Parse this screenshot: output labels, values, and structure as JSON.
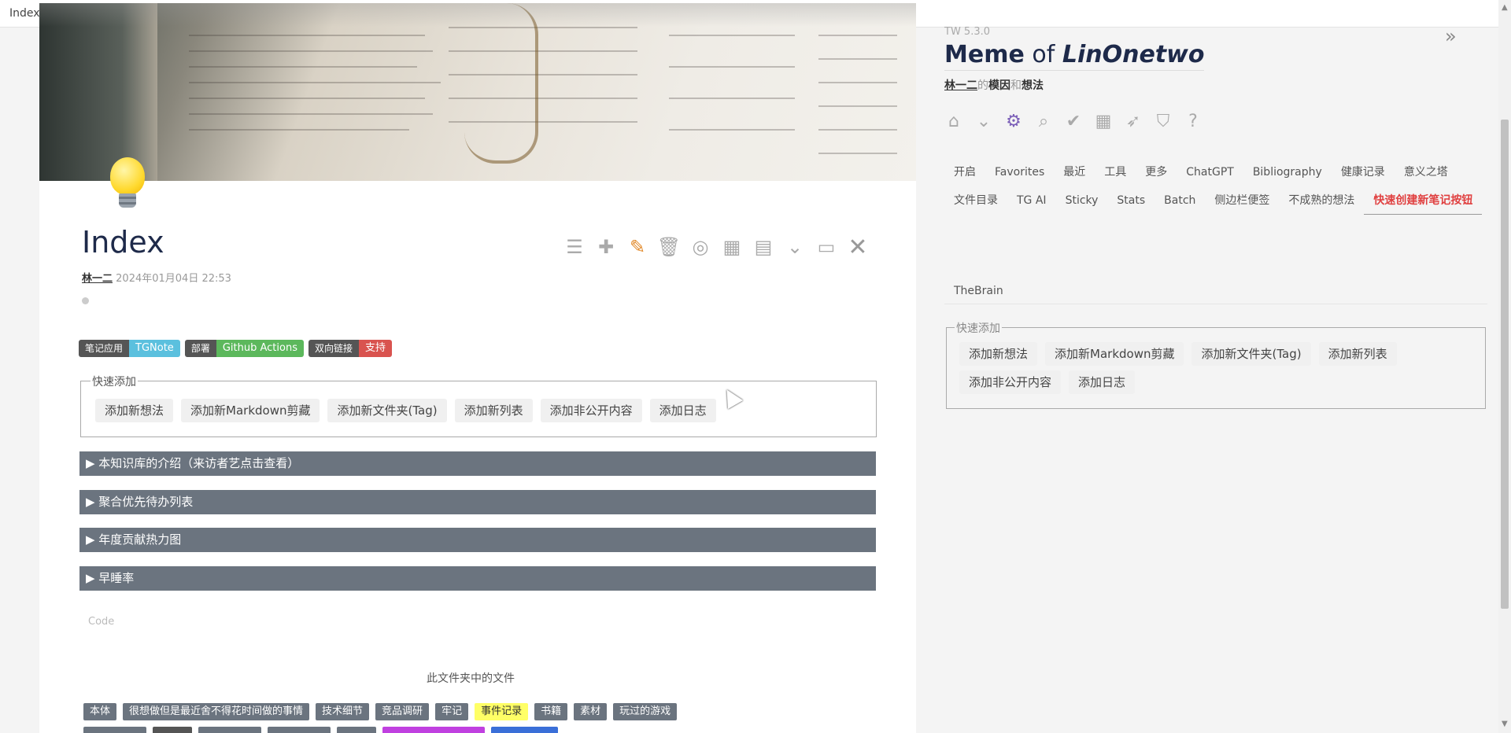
{
  "window": {
    "title": "Index"
  },
  "tiddler": {
    "title": "Index",
    "author": "林一二",
    "date": "2024年01月04日 22:53",
    "badges": [
      {
        "key": "笔记应用",
        "value": "TGNote",
        "color": "#5bc0de"
      },
      {
        "key": "部署",
        "value": "Github Actions",
        "color": "#5cb85c"
      },
      {
        "key": "双向链接",
        "value": "支持",
        "color": "#d9534f"
      }
    ],
    "quick_add": {
      "legend": "快速添加",
      "buttons": [
        "添加新想法",
        "添加新Markdown剪藏",
        "添加新文件夹(Tag)",
        "添加新列表",
        "添加非公开内容",
        "添加日志"
      ]
    },
    "sections": [
      "▶ 本知识库的介绍（来访者艺点击查看）",
      "▶ 聚合优先待办列表",
      "▶ 年度贡献热力图",
      "▶ 早睡率"
    ],
    "code_placeholder": "Code",
    "folder_caption": "此文件夹中的文件",
    "tags": [
      "本体",
      "很想做但是最近舍不得花时间做的事情",
      "技术细节",
      "竞品调研",
      "牢记",
      "事件记录",
      "书籍",
      "素材",
      "玩过的游戏"
    ],
    "toolbar_icons": [
      "list-icon",
      "add-tag-icon",
      "edit-icon",
      "delete-icon",
      "target-icon",
      "qrcode-icon",
      "clipboard-icon",
      "chevron-down-icon",
      "folder-icon",
      "close-icon"
    ]
  },
  "sidebar": {
    "version": "TW 5.3.0",
    "title_a": "Meme",
    "title_of": "of",
    "title_b": "LinOnetwo",
    "subtitle": {
      "a": "林一二",
      "b": "的",
      "c": "模因",
      "d": "和",
      "e": "想法"
    },
    "tabs": [
      "开启",
      "Favorites",
      "最近",
      "工具",
      "更多",
      "ChatGPT",
      "Bibliography",
      "健康记录",
      "意义之塔",
      "文件目录",
      "TG AI",
      "Sticky",
      "Stats",
      "Batch",
      "侧边栏便签",
      "不成熟的想法",
      "快速创建新笔记按钮"
    ],
    "active_tab": "快速创建新笔记按钮",
    "thebrain": "TheBrain",
    "quick_add": {
      "legend": "快速添加",
      "buttons": [
        "添加新想法",
        "添加新Markdown剪藏",
        "添加新文件夹(Tag)",
        "添加新列表",
        "添加非公开内容",
        "添加日志"
      ]
    },
    "icons": [
      "home-icon",
      "chevron-down-icon",
      "gear-icon",
      "search-icon",
      "checkmark-icon",
      "calendar-icon",
      "rocket-icon",
      "filter-icon",
      "help-icon"
    ]
  },
  "colors": {
    "section_bar": "#6b747f",
    "title": "#1e2a4a",
    "active_tab": "#e04040",
    "gear": "#7b5fb8",
    "edit": "#e28a2b"
  }
}
